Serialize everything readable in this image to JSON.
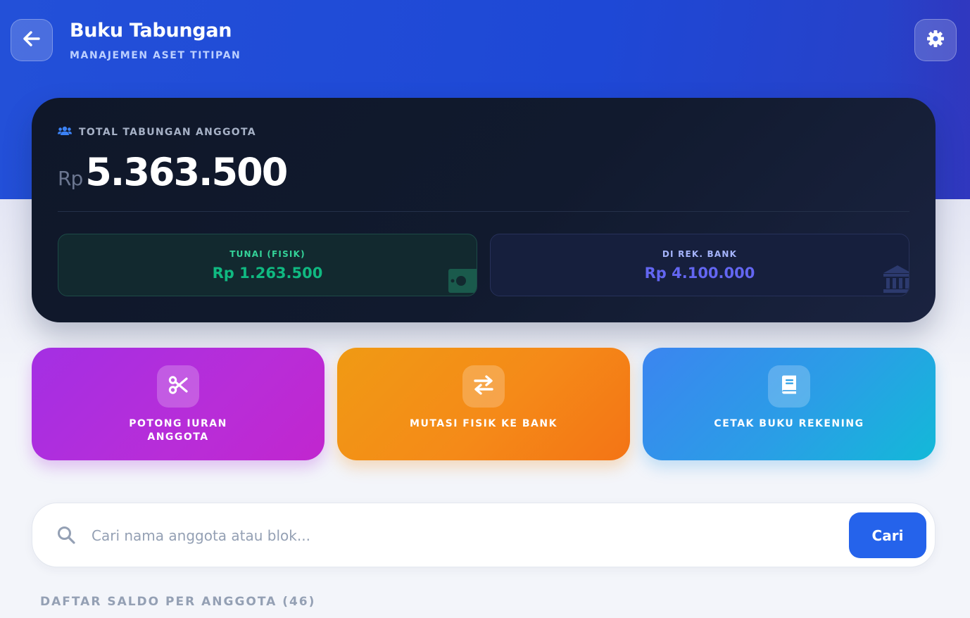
{
  "header": {
    "title": "Buku Tabungan",
    "subtitle": "MANAJEMEN ASET TITIPAN",
    "back_icon": "arrow-left-icon",
    "settings_icon": "gear-icon"
  },
  "summary": {
    "label": "TOTAL TABUNGAN ANGGOTA",
    "label_icon": "users-icon",
    "currency": "Rp",
    "total": "5.363.500",
    "cash": {
      "label": "TUNAI (FISIK)",
      "value": "Rp 1.263.500",
      "icon": "money-bill-icon"
    },
    "bank": {
      "label": "DI REK. BANK",
      "value": "Rp 4.100.000",
      "icon": "bank-icon"
    }
  },
  "actions": [
    {
      "label": "POTONG IURAN ANGGOTA",
      "icon": "scissors-icon",
      "color": "#b12fdd"
    },
    {
      "label": "MUTASI FISIK KE BANK",
      "icon": "exchange-arrows-icon",
      "color": "#f58a18"
    },
    {
      "label": "CETAK BUKU REKENING",
      "icon": "book-icon",
      "color": "#2a9ee6"
    }
  ],
  "search": {
    "placeholder": "Cari nama anggota atau blok...",
    "value": "",
    "button_label": "Cari",
    "button_color": "#2563eb"
  },
  "list": {
    "heading": "DAFTAR SALDO PER ANGGOTA (46)"
  }
}
